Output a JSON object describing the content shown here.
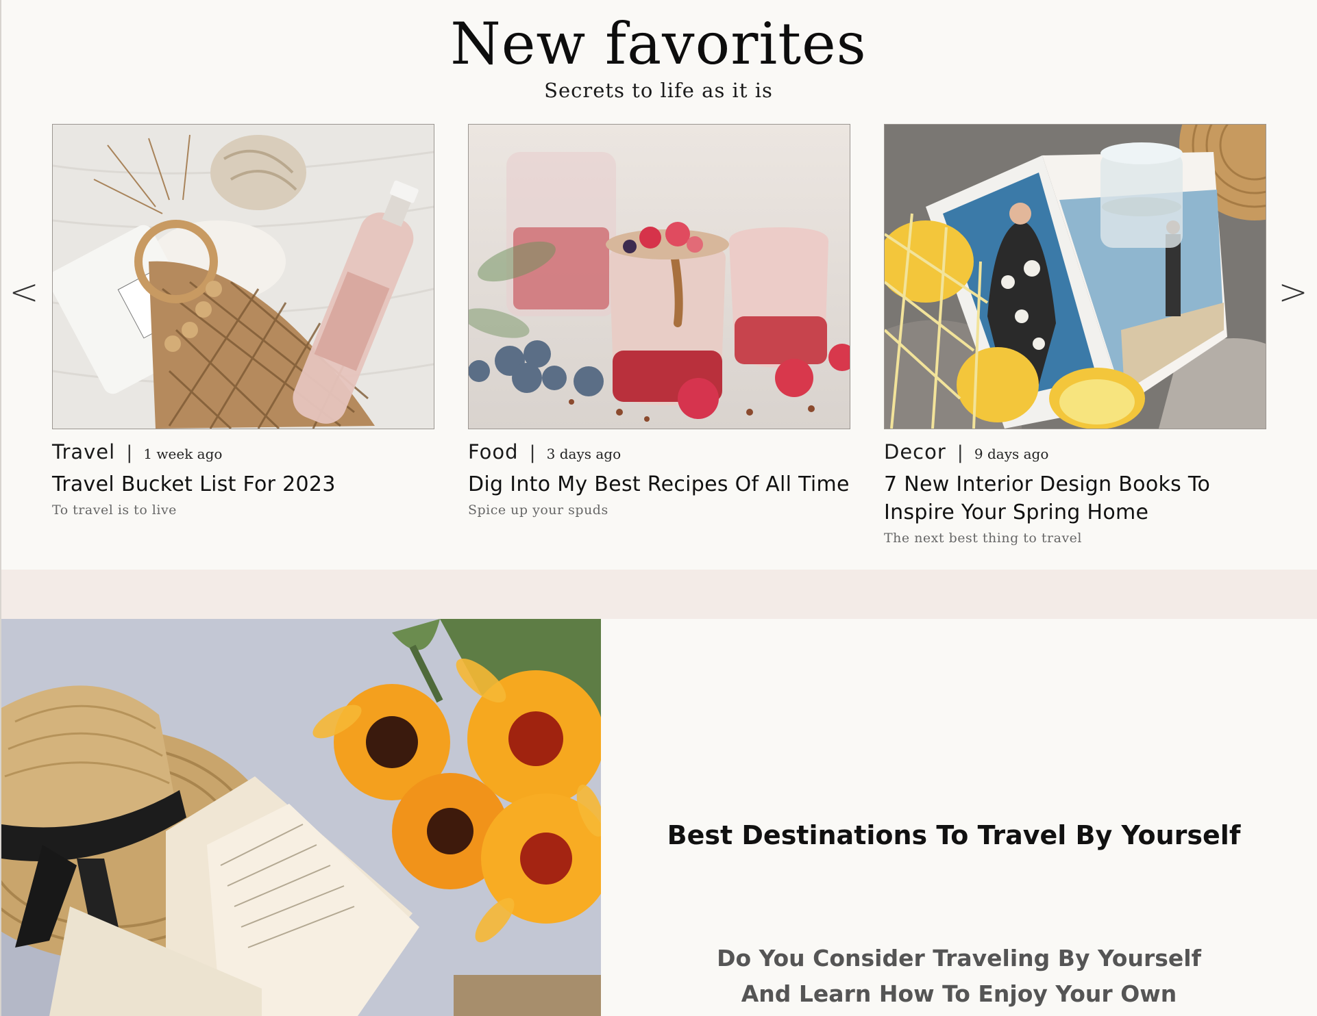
{
  "header": {
    "title": "New favorites",
    "subtitle": "Secrets to life as it is"
  },
  "carousel": {
    "prev_icon": "chevron-left-icon",
    "next_icon": "chevron-right-icon",
    "prev_glyph": "<",
    "next_glyph": ">"
  },
  "cards": [
    {
      "category": "Travel",
      "separator": "|",
      "time": "1 week ago",
      "title": "Travel Bucket List For 2023",
      "subtitle": "To travel is to live"
    },
    {
      "category": "Food",
      "separator": "|",
      "time": "3 days ago",
      "title": "Dig Into My Best Recipes Of All Time",
      "subtitle": "Spice up your spuds"
    },
    {
      "category": "Decor",
      "separator": "|",
      "time": "9 days ago",
      "title": "7 New Interior Design Books To Inspire Your Spring Home",
      "subtitle": "The next best thing to travel"
    }
  ],
  "feature": {
    "title": "Best Destinations To Travel By Yourself",
    "description_line1": "Do You Consider Traveling  By Yourself",
    "description_line2": "And Learn How To Enjoy Your Own"
  },
  "colors": {
    "background": "#faf9f6",
    "band": "#f3ebe7",
    "text": "#1a1a1a",
    "muted": "#666666"
  }
}
